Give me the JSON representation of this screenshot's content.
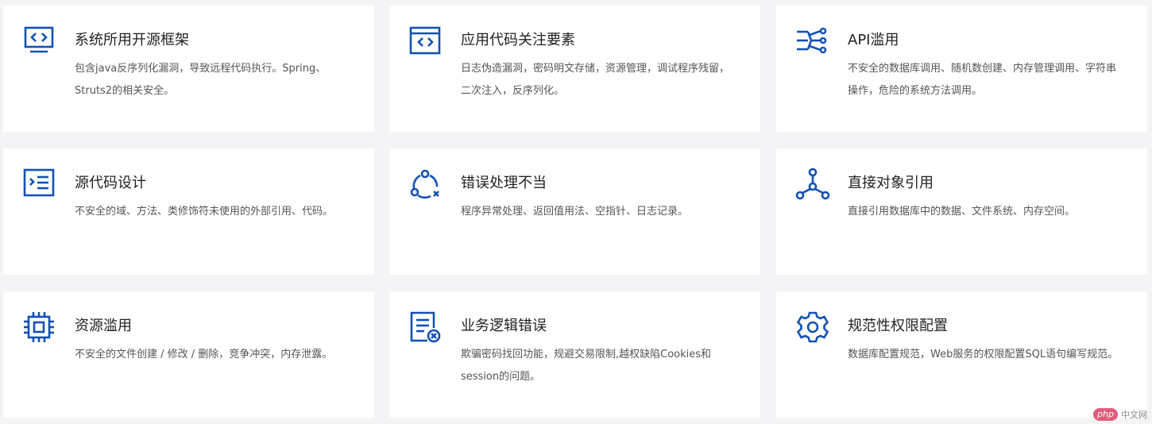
{
  "colors": {
    "icon": "#1351b4",
    "title": "#222222",
    "desc": "#555555",
    "card": "#ffffff",
    "background": "#f4f4f7"
  },
  "cards": [
    {
      "icon": "monitor-code-icon",
      "title": "系统所用开源框架",
      "desc": "包含java反序列化漏洞，导致远程代码执行。Spring、Struts2的相关安全。"
    },
    {
      "icon": "browser-code-icon",
      "title": "应用代码关注要素",
      "desc": "日志伪造漏洞，密码明文存储，资源管理，调试程序残留，二次注入，反序列化。"
    },
    {
      "icon": "api-network-icon",
      "title": "API滥用",
      "desc": "不安全的数据库调用、随机数创建、内存管理调用、字符串操作，危险的系统方法调用。"
    },
    {
      "icon": "code-list-icon",
      "title": "源代码设计",
      "desc": "不安全的域、方法、类修饰符未使用的外部引用、代码。"
    },
    {
      "icon": "error-cycle-icon",
      "title": "错误处理不当",
      "desc": "程序异常处理、返回值用法、空指针、日志记录。"
    },
    {
      "icon": "object-graph-icon",
      "title": "直接对象引用",
      "desc": "直接引用数据库中的数据、文件系统、内存空间。"
    },
    {
      "icon": "chip-icon",
      "title": "资源滥用",
      "desc": "不安全的文件创建 / 修改 / 删除，竞争冲突，内存泄露。"
    },
    {
      "icon": "document-error-icon",
      "title": "业务逻辑错误",
      "desc": "欺骗密码找回功能，规避交易限制,越权缺陷Cookies和session的问题。"
    },
    {
      "icon": "gear-icon",
      "title": "规范性权限配置",
      "desc": "数据库配置规范，Web服务的权限配置SQL语句编写规范。"
    }
  ],
  "watermark": {
    "logo": "php",
    "text": "中文网"
  }
}
